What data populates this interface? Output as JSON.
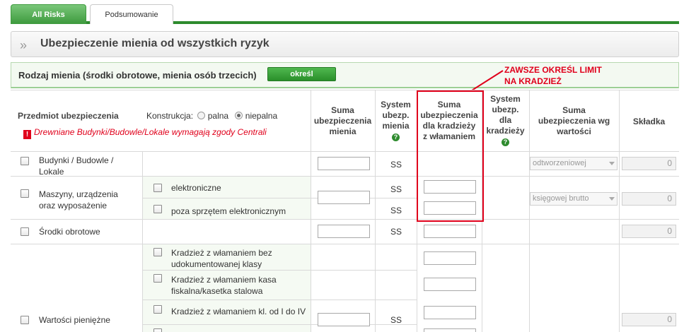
{
  "tabs": [
    {
      "label": "All Risks"
    },
    {
      "label": "Podsumowanie"
    }
  ],
  "section": {
    "title": "Ubezpieczenie mienia od wszystkich ryzyk"
  },
  "property_type": {
    "label": "Rodzaj mienia (środki obrotowe, mienia osób trzecich)",
    "button": "określ"
  },
  "annotation": {
    "line1": "ZAWSZE OKREŚL LIMIT",
    "line2": "NA KRADZIEŻ"
  },
  "table": {
    "headers": {
      "subject": "Przedmiot ubezpieczenia",
      "construction_label": "Konstrukcja:",
      "construction_opt1": "palna",
      "construction_opt2": "niepalna",
      "sum_insured_l1": "Suma",
      "sum_insured_l2": "ubezpieczenia",
      "sum_insured_l3": "mienia",
      "system_l1": "System",
      "system_l2": "ubezp.",
      "system_l3": "mienia",
      "theft_sum_l1": "Suma",
      "theft_sum_l2": "ubezpieczenia",
      "theft_sum_l3": "dla kradzieży",
      "theft_sum_l4": "z włamaniem",
      "theft_system_l1": "System",
      "theft_system_l2": "ubezp.",
      "theft_system_l3": "dla",
      "theft_system_l4": "kradzieży",
      "value_sum_l1": "Suma",
      "value_sum_l2": "ubezpieczenia wg",
      "value_sum_l3": "wartości",
      "premium": "Składka"
    },
    "warning": "Drewniane Budynki/Budowle/Lokale wymagają zgody Centrali",
    "rows": {
      "buildings": {
        "label_l1": "Budynki / Budowle /",
        "label_l2": "Lokale",
        "system": "SS",
        "valuation": "odtworzeniowej",
        "premium": "0"
      },
      "machines": {
        "label_l1": "Maszyny, urządzenia",
        "label_l2": "oraz wyposażenie",
        "sub1": "elektroniczne",
        "sub2": "poza sprzętem elektronicznym",
        "system1": "SS",
        "system2": "SS",
        "valuation": "księgowej brutto",
        "premium": "0"
      },
      "current_assets": {
        "label": "Środki obrotowe",
        "system": "SS",
        "premium": "0"
      },
      "cash": {
        "label": "Wartości pieniężne",
        "sub1_l1": "Kradzież z włamaniem bez",
        "sub1_l2": "udokumentowanej klasy",
        "sub2_l1": "Kradzież z włamaniem kasa",
        "sub2_l2": "fiskalna/kasetka stalowa",
        "sub3": "Kradzież z włamaniem kl. od I do IV",
        "system": "SS",
        "premium": "0"
      }
    }
  }
}
